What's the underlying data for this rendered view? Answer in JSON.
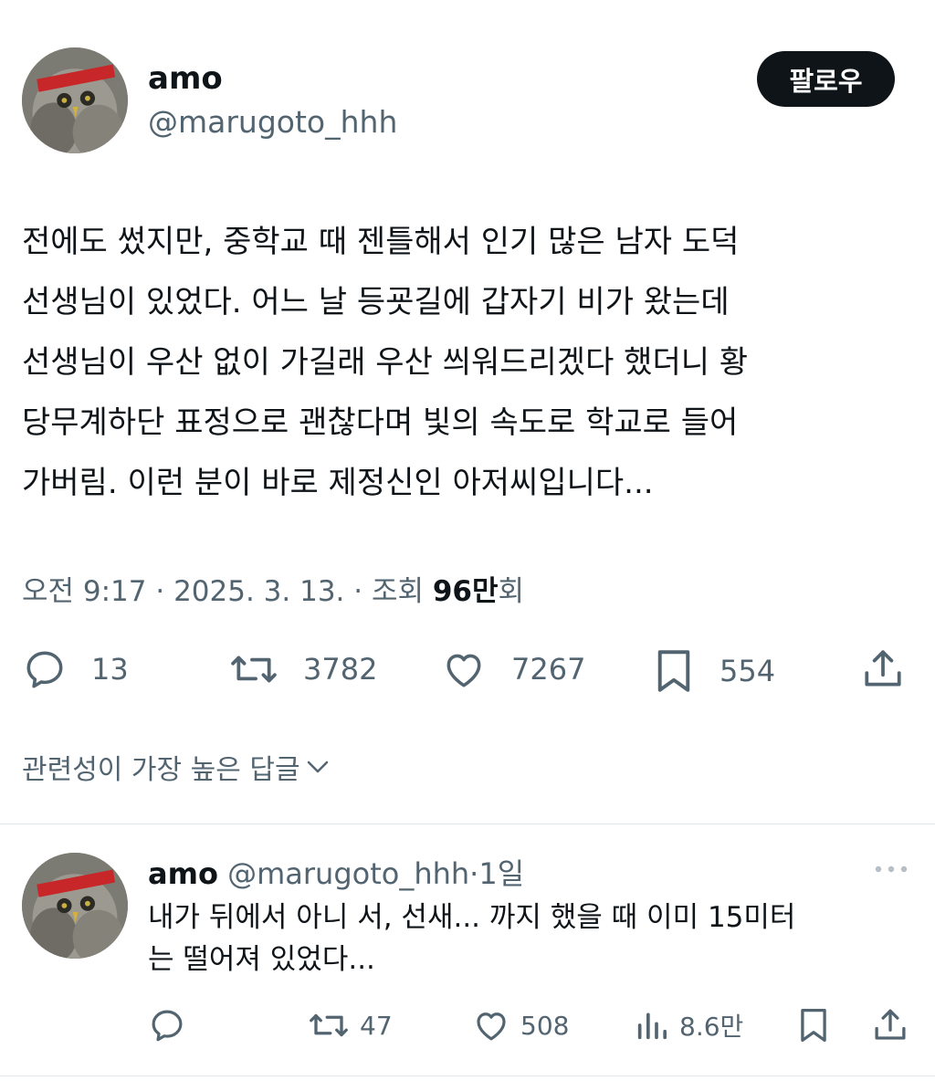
{
  "tweet": {
    "author_name": "amo",
    "author_handle": "@marugoto_hhh",
    "follow_label": "팔로우",
    "text": "전에도 썼지만, 중학교 때 젠틀해서 인기 많은 남자 도덕\n선생님이 있었다. 어느 날 등굣길에 갑자기 비가 왔는데\n선생님이 우산 없이 가길래 우산 씌워드리겠다 했더니 황\n당무계하단 표정으로 괜찮다며 빛의 속도로 학교로 들어\n가버림. 이런 분이 바로 제정신인 아저씨입니다...",
    "meta_prefix": "오전 9:17 · 2025. 3. 13. · 조회 ",
    "views_value": "96만",
    "views_suffix": "회",
    "stats": {
      "replies": "13",
      "retweets": "3782",
      "likes": "7267",
      "bookmarks": "554"
    }
  },
  "replies_sort_label": "관련성이 가장 높은 답글",
  "reply": {
    "author_name": "amo",
    "author_handle": "@marugoto_hhh",
    "dot": "·",
    "time": "1일",
    "text": "내가 뒤에서 아니 서, 선새... 까지 했을 때 이미 15미터\n는 떨어져 있었다...",
    "stats": {
      "retweets": "47",
      "likes": "508",
      "views": "8.6만"
    }
  },
  "colors": {
    "text_primary": "#0f1419",
    "text_secondary": "#536471",
    "follow_bg": "#0f1419",
    "divider": "#e1e6ea"
  },
  "icons": [
    "reply-icon",
    "retweet-icon",
    "like-icon",
    "bookmark-icon",
    "share-icon",
    "chevron-down-icon",
    "more-icon",
    "views-icon"
  ]
}
